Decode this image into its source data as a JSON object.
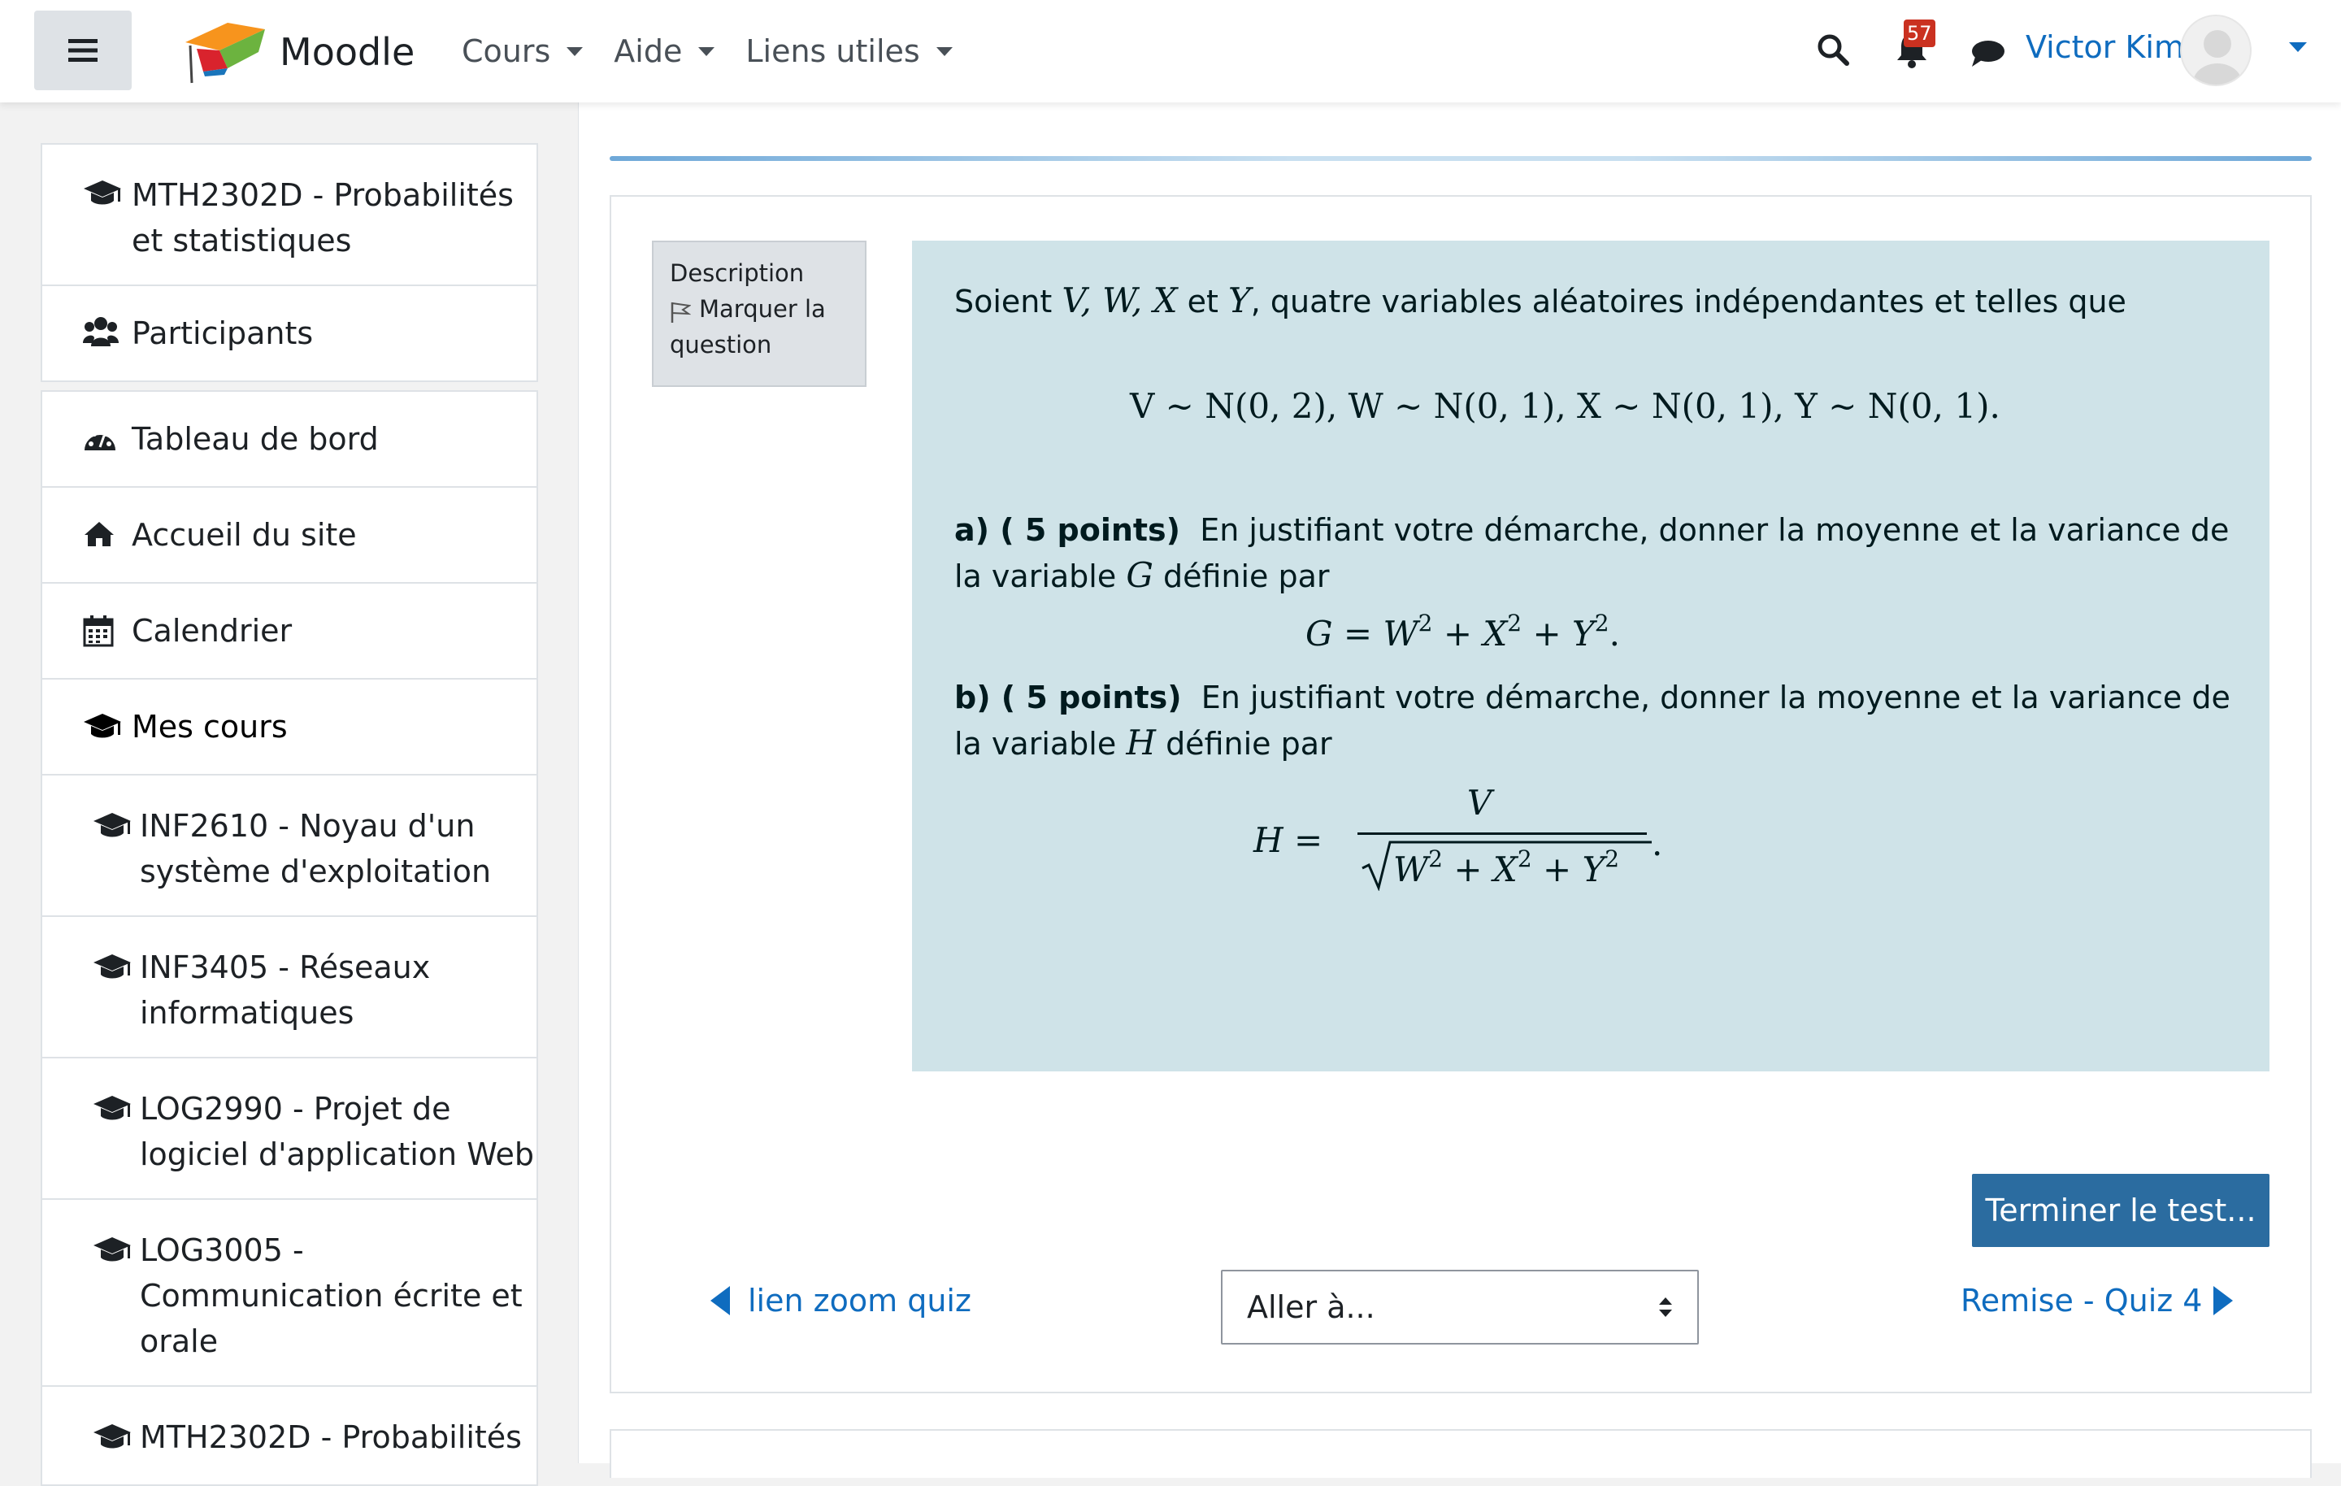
{
  "navbar": {
    "brand": "Moodle",
    "menu": [
      {
        "label": "Cours"
      },
      {
        "label": "Aide"
      },
      {
        "label": "Liens utiles"
      }
    ],
    "notification_count": "57",
    "user_name": "Victor Kim"
  },
  "drawer": {
    "course_group": [
      {
        "label": "MTH2302D - Probabilités",
        "label2": "et statistiques",
        "icon": "graduation-cap-icon"
      },
      {
        "label": "Participants",
        "icon": "users-icon"
      }
    ],
    "nav_group": [
      {
        "label": "Tableau de bord",
        "icon": "dashboard-icon"
      },
      {
        "label": "Accueil du site",
        "icon": "home-icon"
      },
      {
        "label": "Calendrier",
        "icon": "calendar-icon"
      },
      {
        "label": "Mes cours",
        "icon": "graduation-cap-icon"
      },
      {
        "label": "INF2610 - Noyau d'un",
        "label2": "système d'exploitation",
        "icon": "graduation-cap-icon"
      },
      {
        "label": "INF3405 - Réseaux",
        "label2": "informatiques",
        "icon": "graduation-cap-icon"
      },
      {
        "label": "LOG2990 - Projet de",
        "label2": "logiciel d'application Web",
        "icon": "graduation-cap-icon"
      },
      {
        "label": "LOG3005 -",
        "label2": "Communication écrite et",
        "label3": "orale",
        "icon": "graduation-cap-icon"
      },
      {
        "label": "MTH2302D - Probabilités",
        "icon": "graduation-cap-icon"
      }
    ]
  },
  "question": {
    "info_label": "Description",
    "flag_label": "Marquer la",
    "flag_label2": "question",
    "intro_prefix": "Soient",
    "intro_vars": "V, W, X",
    "intro_et": "et",
    "intro_y": "Y",
    "intro_suffix": ", quatre variables aléatoires indépendantes et telles que",
    "distributions": "V ∼ N(0, 2),    W ∼ N(0, 1),    X ∼ N(0, 1),    Y ∼ N(0, 1).",
    "part_a_head": "a) ( 5 points)",
    "part_a_text": "En justifiant votre démarche, donner la moyenne et la variance de la variable",
    "part_a_var": "G",
    "part_a_tail": "définie par",
    "part_b_head": "b) ( 5 points)",
    "part_b_text": "En justifiant votre démarche, donner la moyenne et la variance de la variable",
    "part_b_var": "H",
    "part_b_tail": "définie par"
  },
  "actions": {
    "finish_label": "Terminer le test...",
    "prev_label": "lien zoom quiz",
    "jump_value": "Aller à...",
    "next_label": "Remise - Quiz 4"
  },
  "colors": {
    "accent": "#0f6cbf",
    "finish_button": "#2b6ca0",
    "question_background": "#cfe3e8",
    "badge": "#ca3120"
  }
}
